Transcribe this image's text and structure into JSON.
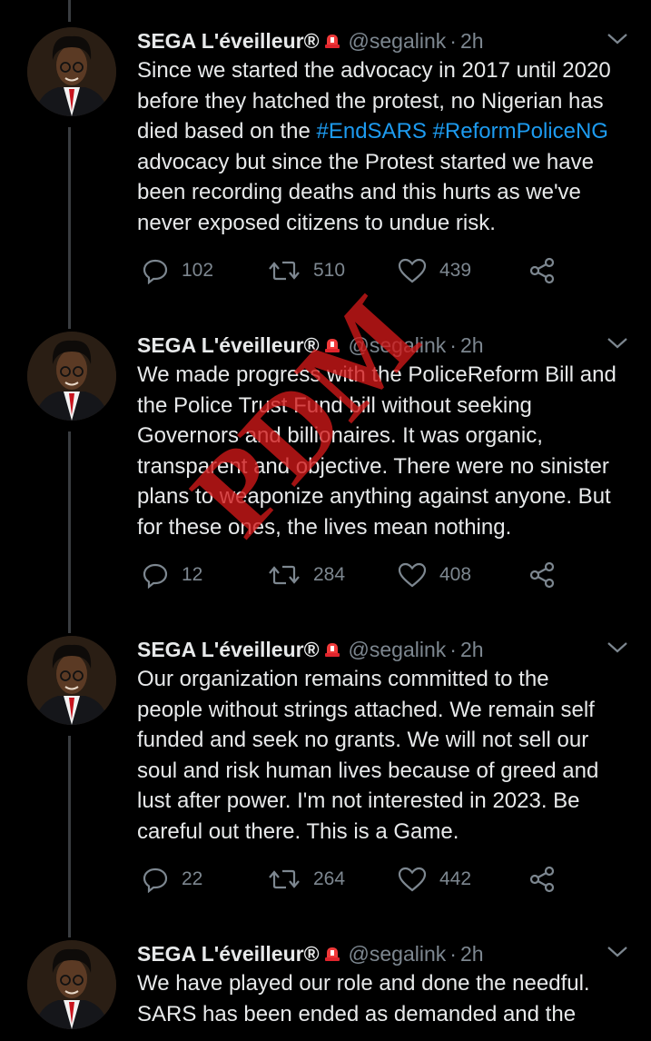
{
  "colors": {
    "background": "#000000",
    "text": "#e7e9ea",
    "muted": "#7d8790",
    "hashtag": "#1d9bf0",
    "thread_line": "#3a3d41",
    "watermark": "#d11818"
  },
  "watermark": {
    "text": "PDM"
  },
  "tweets": [
    {
      "author": {
        "name": "SEGA L'éveilleur®",
        "badge_icon": "siren-icon",
        "handle": "@segalink"
      },
      "time": "2h",
      "text_before": "Since we started the advocacy in 2017 until 2020\nbefore they hatched the protest, no Nigerian has\ndied based on the ",
      "hashtag_1": "#EndSARS",
      "hashtag_2": "#ReformPoliceNG",
      "text_after": "\nadvocacy but since the Protest started we have\nbeen recording deaths and this hurts as we've\nnever exposed citizens to undue risk.",
      "replies": "102",
      "retweets": "510",
      "likes": "439"
    },
    {
      "author": {
        "name": "SEGA L'éveilleur®",
        "badge_icon": "siren-icon",
        "handle": "@segalink"
      },
      "time": "2h",
      "text": "We made progress with the PoliceReform Bill and\nthe Police Trust Fund bill without seeking\nGovernors and billionaires. It was organic,\ntransparent and objective. There were no sinister\nplans to weaponize anything against anyone. But\nfor these ones, the lives mean nothing.",
      "replies": "12",
      "retweets": "284",
      "likes": "408"
    },
    {
      "author": {
        "name": "SEGA L'éveilleur®",
        "badge_icon": "siren-icon",
        "handle": "@segalink"
      },
      "time": "2h",
      "text": "Our organization remains committed to the\npeople without strings attached. We remain self\nfunded and seek no grants. We will not sell our\nsoul and risk human lives because of greed and\nlust after power. I'm not interested in 2023. Be\ncareful out there. This is a Game.",
      "replies": "22",
      "retweets": "264",
      "likes": "442"
    },
    {
      "author": {
        "name": "SEGA L'éveilleur®",
        "badge_icon": "siren-icon",
        "handle": "@segalink"
      },
      "time": "2h",
      "text": "We have played our role and done the needful.\nSARS has been ended as demanded and the"
    }
  ]
}
